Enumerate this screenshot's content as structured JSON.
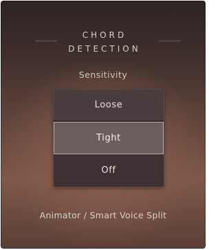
{
  "section": {
    "title_line1": "CHORD",
    "title_line2": "DETECTION"
  },
  "sensitivity": {
    "label": "Sensitivity",
    "options": [
      "Loose",
      "Tight",
      "Off"
    ],
    "selected": "Tight"
  },
  "footer": {
    "label": "Animator / Smart Voice Split"
  }
}
